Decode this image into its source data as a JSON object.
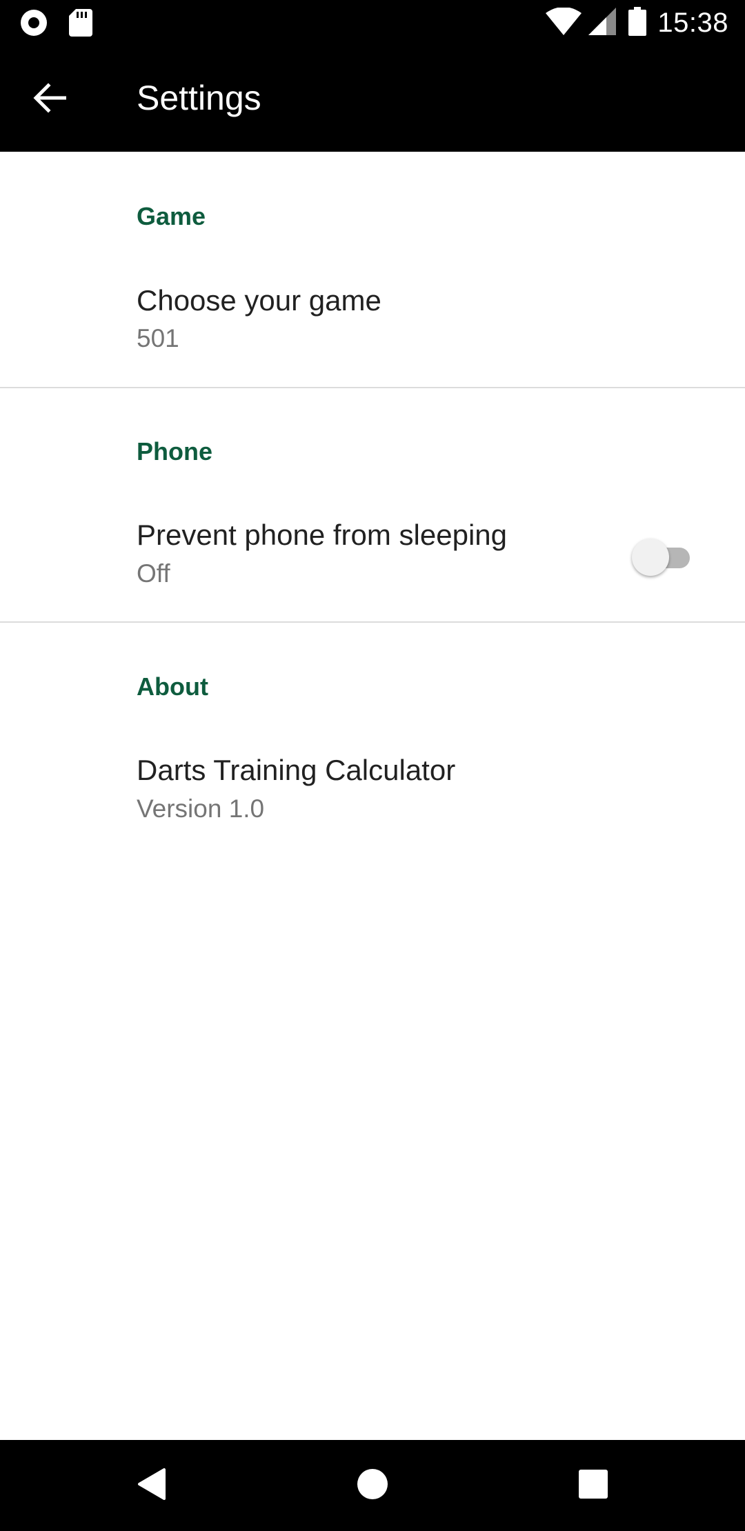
{
  "status_bar": {
    "time": "15:38",
    "icons": [
      "record-icon",
      "sd-card-icon",
      "wifi-icon",
      "cell-signal-icon",
      "battery-icon"
    ]
  },
  "toolbar": {
    "back_icon": "arrow-back-icon",
    "title": "Settings"
  },
  "sections": [
    {
      "header": "Game",
      "items": [
        {
          "title": "Choose your game",
          "summary": "501"
        }
      ]
    },
    {
      "header": "Phone",
      "items": [
        {
          "title": "Prevent phone from sleeping",
          "summary": "Off",
          "switch_on": false
        }
      ]
    },
    {
      "header": "About",
      "items": [
        {
          "title": "Darts Training Calculator",
          "summary": "Version 1.0"
        }
      ]
    }
  ],
  "nav_bar": {
    "icons": [
      "nav-back-icon",
      "nav-home-icon",
      "nav-recents-icon"
    ]
  },
  "colors": {
    "accent": "#0e5c3e",
    "bar_background": "#000000",
    "title_text": "#212121",
    "summary_text": "#757575"
  }
}
